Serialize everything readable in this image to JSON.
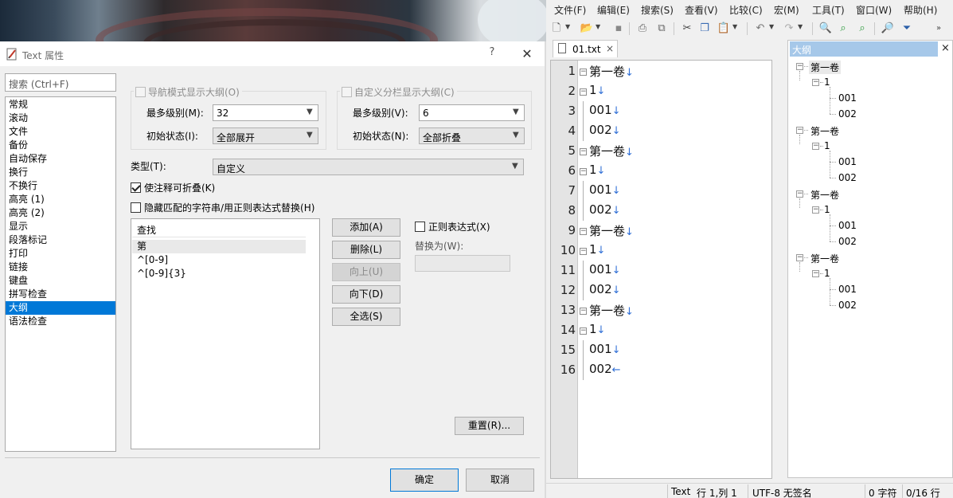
{
  "dialog": {
    "title": "Text 属性",
    "help": "?",
    "close": "✕",
    "search_placeholder": "搜索 (Ctrl+F)",
    "categories": [
      "常规",
      "滚动",
      "文件",
      "备份",
      "自动保存",
      "换行",
      "不换行",
      "高亮 (1)",
      "高亮 (2)",
      "显示",
      "段落标记",
      "打印",
      "链接",
      "键盘",
      "拼写检查",
      "大纲",
      "语法检查"
    ],
    "selected_category": "大纲",
    "nav_group": {
      "title": "导航模式显示大纲(O)",
      "max_level_label": "最多级别(M):",
      "max_level_value": "32",
      "init_state_label": "初始状态(I):",
      "init_state_value": "全部展开"
    },
    "split_group": {
      "title": "自定义分栏显示大纲(C)",
      "max_level_label": "最多级别(V):",
      "max_level_value": "6",
      "init_state_label": "初始状态(N):",
      "init_state_value": "全部折叠"
    },
    "type_label": "类型(T):",
    "type_value": "自定义",
    "fold_comments_label": "使注释可折叠(K)",
    "hide_match_label": "隐藏匹配的字符串/用正则表达式替换(H)",
    "find_header": "查找",
    "find_rows": [
      "第",
      "^[0-9]",
      "^[0-9]{3}"
    ],
    "buttons": {
      "add": "添加(A)",
      "delete": "删除(L)",
      "up": "向上(U)",
      "down": "向下(D)",
      "select_all": "全选(S)",
      "reset": "重置(R)...",
      "ok": "确定",
      "cancel": "取消"
    },
    "regex_label": "正则表达式(X)",
    "replace_label": "替换为(W):"
  },
  "editor": {
    "menu": [
      "文件(F)",
      "编辑(E)",
      "搜索(S)",
      "查看(V)",
      "比较(C)",
      "宏(M)",
      "工具(T)",
      "窗口(W)",
      "帮助(H)"
    ],
    "tab_label": "01.txt",
    "tab_close": "×",
    "lines": [
      {
        "num": "1",
        "text": "第一卷",
        "eol": "↓",
        "fold": "−"
      },
      {
        "num": "2",
        "text": "1",
        "eol": "↓",
        "fold": "−"
      },
      {
        "num": "3",
        "text": "001",
        "eol": "↓",
        "fold": ""
      },
      {
        "num": "4",
        "text": "002",
        "eol": "↓",
        "fold": ""
      },
      {
        "num": "5",
        "text": "第一卷",
        "eol": "↓",
        "fold": "−"
      },
      {
        "num": "6",
        "text": "1",
        "eol": "↓",
        "fold": "−"
      },
      {
        "num": "7",
        "text": "001",
        "eol": "↓",
        "fold": ""
      },
      {
        "num": "8",
        "text": "002",
        "eol": "↓",
        "fold": ""
      },
      {
        "num": "9",
        "text": "第一卷",
        "eol": "↓",
        "fold": "−"
      },
      {
        "num": "10",
        "text": "1",
        "eol": "↓",
        "fold": "−"
      },
      {
        "num": "11",
        "text": "001",
        "eol": "↓",
        "fold": ""
      },
      {
        "num": "12",
        "text": "002",
        "eol": "↓",
        "fold": ""
      },
      {
        "num": "13",
        "text": "第一卷",
        "eol": "↓",
        "fold": "−"
      },
      {
        "num": "14",
        "text": "1",
        "eol": "↓",
        "fold": "−"
      },
      {
        "num": "15",
        "text": "001",
        "eol": "↓",
        "fold": ""
      },
      {
        "num": "16",
        "text": "002",
        "eol": "←",
        "fold": ""
      }
    ],
    "outline": {
      "title": "大纲",
      "close": "×",
      "groups": [
        {
          "chapter": "第一卷",
          "section": "1",
          "items": [
            "001",
            "002"
          ]
        },
        {
          "chapter": "第一卷",
          "section": "1",
          "items": [
            "001",
            "002"
          ]
        },
        {
          "chapter": "第一卷",
          "section": "1",
          "items": [
            "001",
            "002"
          ]
        },
        {
          "chapter": "第一卷",
          "section": "1",
          "items": [
            "001",
            "002"
          ]
        }
      ]
    },
    "status": {
      "mode": "Text",
      "position": "行 1,列 1",
      "encoding": "UTF-8 无签名",
      "chars": "0 字符",
      "lines": "0/16 行"
    }
  }
}
